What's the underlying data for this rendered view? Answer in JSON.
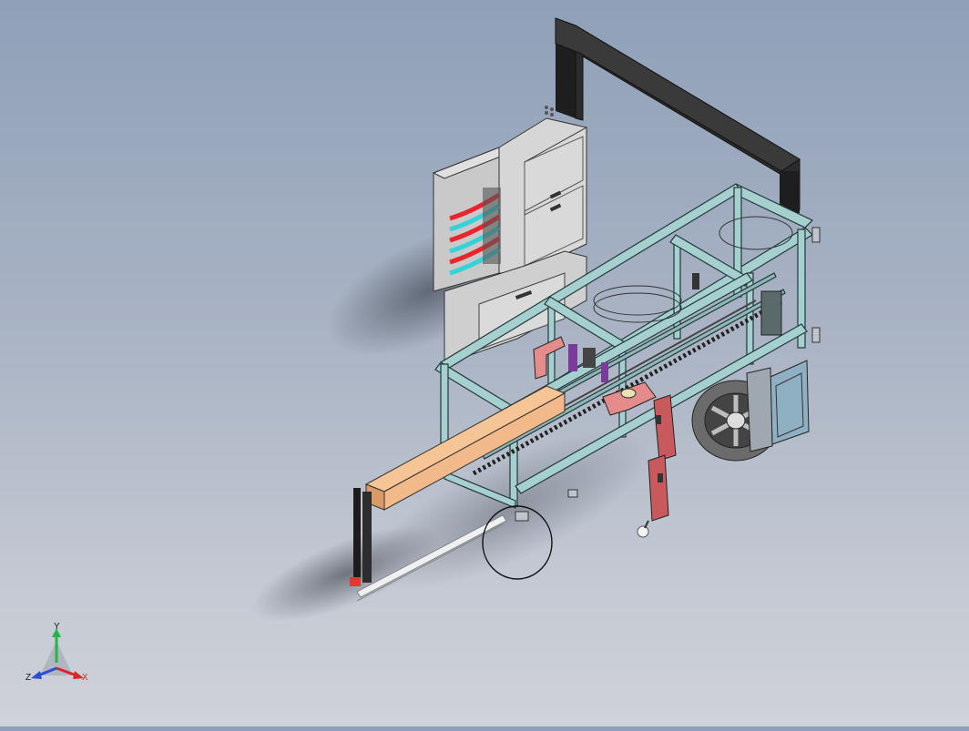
{
  "triad": {
    "x_label": "X",
    "y_label": "Y",
    "z_label": "Z",
    "x_color": "#d9262a",
    "y_color": "#27b24a",
    "z_color": "#2a4fd6"
  },
  "colors": {
    "background_top": "#8fa0b8",
    "background_bottom": "#cfd2d9",
    "frame": "#a6cfcf",
    "frame_edge": "#223838",
    "cabinet": "#d3d3d3",
    "arch": "#2a2a2a",
    "timber": "#f2b98a",
    "red_arm": "#c8595d",
    "pink_part": "#e48b8b",
    "hose_red": "#e8242d",
    "hose_cyan": "#33d3d9"
  },
  "icons": [
    "coordinate-triad-icon"
  ]
}
